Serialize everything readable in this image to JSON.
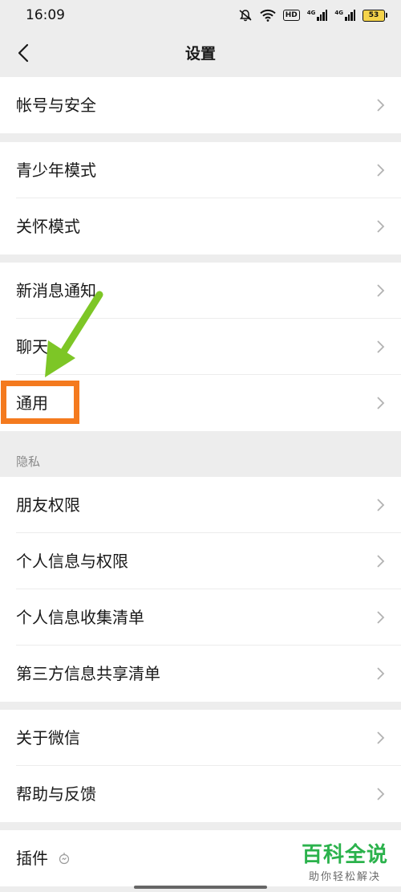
{
  "status_bar": {
    "time": "16:09",
    "hd": "HD",
    "signal_1": "4G",
    "signal_2": "4G",
    "battery": "53"
  },
  "nav": {
    "title": "设置"
  },
  "groups": {
    "account": {
      "items": [
        {
          "label": "帐号与安全"
        }
      ]
    },
    "modes": {
      "items": [
        {
          "label": "青少年模式"
        },
        {
          "label": "关怀模式"
        }
      ]
    },
    "general": {
      "items": [
        {
          "label": "新消息通知"
        },
        {
          "label": "聊天"
        },
        {
          "label": "通用"
        }
      ]
    },
    "privacy": {
      "header": "隐私",
      "items": [
        {
          "label": "朋友权限"
        },
        {
          "label": "个人信息与权限"
        },
        {
          "label": "个人信息收集清单"
        },
        {
          "label": "第三方信息共享清单"
        }
      ]
    },
    "about": {
      "items": [
        {
          "label": "关于微信"
        },
        {
          "label": "帮助与反馈"
        }
      ]
    },
    "plugins": {
      "items": [
        {
          "label": "插件"
        }
      ]
    }
  },
  "annotation": {
    "highlight_color": "#f47a1e",
    "arrow_color": "#7dc626",
    "highlighted_item": "通用"
  },
  "watermark": {
    "title": "百科全说",
    "subtitle": "助你轻松解决"
  },
  "colors": {
    "background": "#ededed",
    "row": "#ffffff",
    "text": "#191919",
    "chevron": "#b2b2b2",
    "watermark": "#2bb24c"
  }
}
